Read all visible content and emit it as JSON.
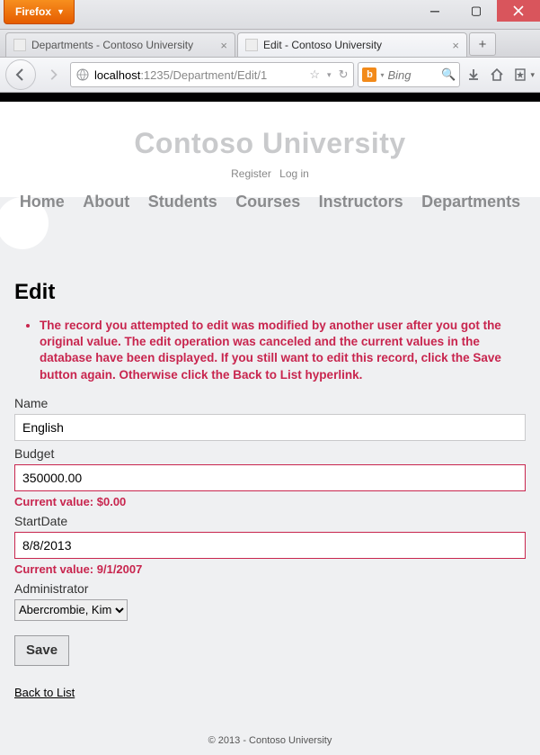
{
  "browser": {
    "menu_label": "Firefox",
    "tabs": [
      {
        "title": "Departments - Contoso University"
      },
      {
        "title": "Edit - Contoso University"
      }
    ],
    "url_host": "localhost",
    "url_path": ":1235/Department/Edit/1",
    "search_placeholder": "Bing"
  },
  "header": {
    "brand": "Contoso University",
    "account": {
      "register": "Register",
      "login": "Log in"
    },
    "nav": [
      "Home",
      "About",
      "Students",
      "Courses",
      "Instructors",
      "Departments"
    ]
  },
  "page": {
    "heading": "Edit",
    "error": "The record you attempted to edit was modified by another user after you got the original value. The edit operation was canceled and the current values in the database have been displayed. If you still want to edit this record, click the Save button again. Otherwise click the Back to List hyperlink.",
    "fields": {
      "name": {
        "label": "Name",
        "value": "English"
      },
      "budget": {
        "label": "Budget",
        "value": "350000.00",
        "current": "Current value: $0.00"
      },
      "startdate": {
        "label": "StartDate",
        "value": "8/8/2013",
        "current": "Current value: 9/1/2007"
      },
      "admin": {
        "label": "Administrator",
        "value": "Abercrombie, Kim"
      }
    },
    "save_label": "Save",
    "back_label": "Back to List"
  },
  "footer": {
    "text": "© 2013 - Contoso University"
  }
}
